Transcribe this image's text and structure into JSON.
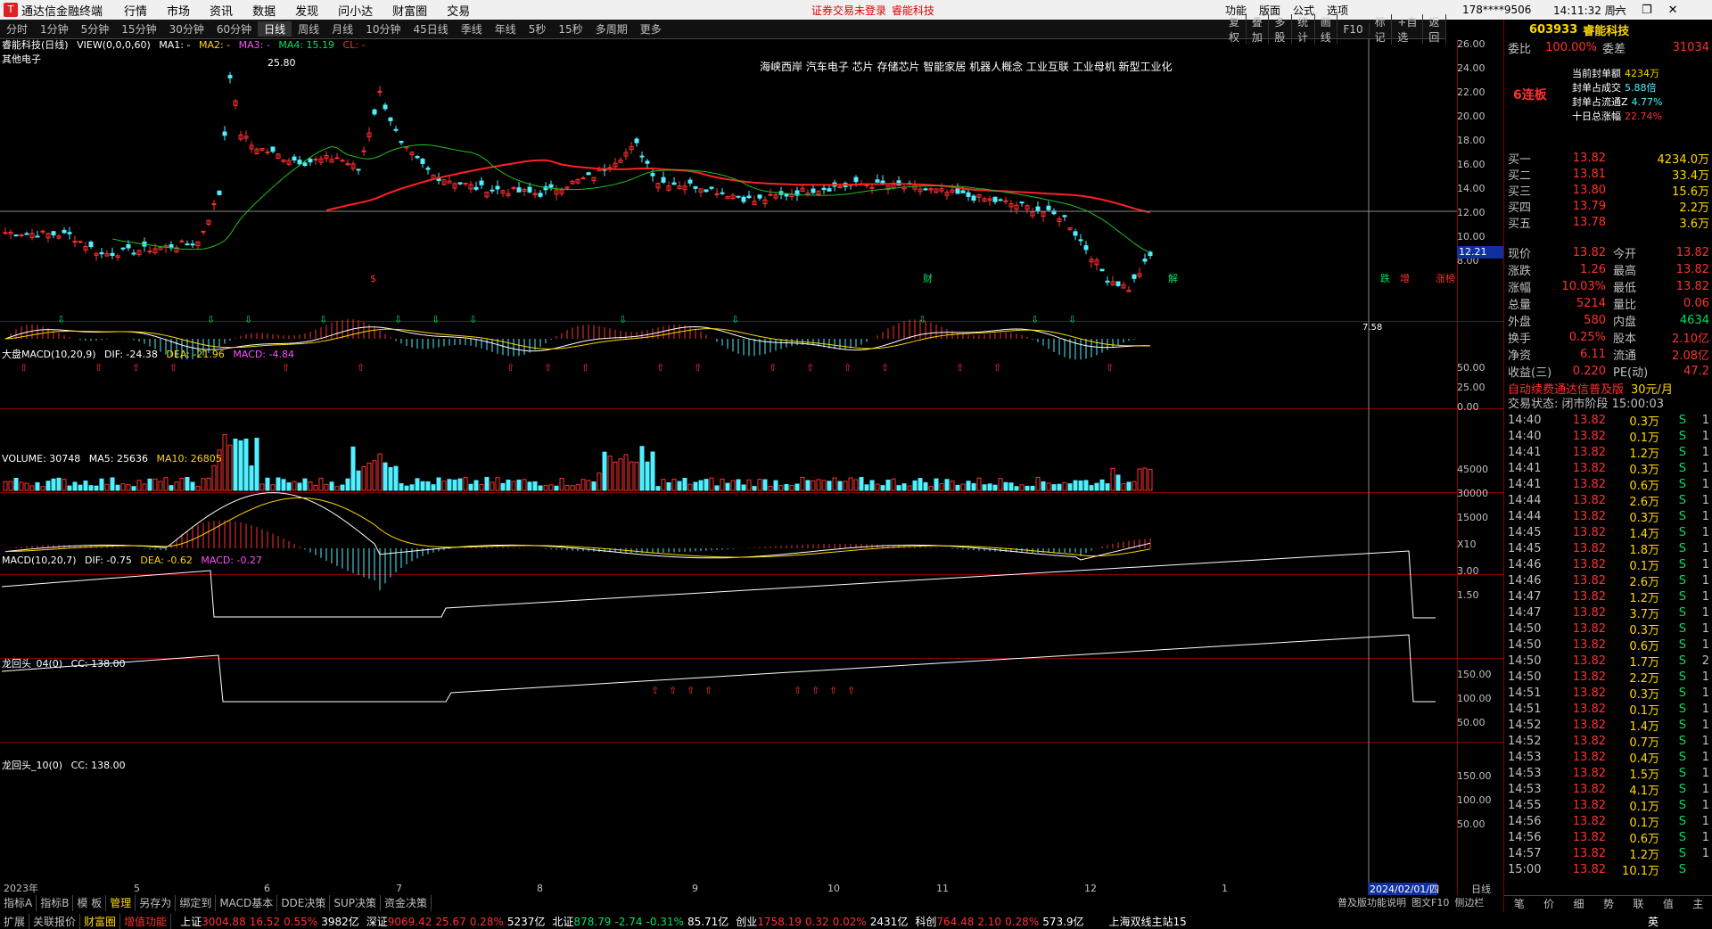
{
  "titlebar": {
    "app": "通达信金融终端",
    "menu": [
      "行情",
      "市场",
      "资讯",
      "数据",
      "发现",
      "问小达",
      "财富圈",
      "交易"
    ],
    "warning": "证券交易未登录",
    "stock": "睿能科技",
    "right_menu": [
      "功能",
      "版面",
      "公式",
      "选项"
    ],
    "user": "178****9506",
    "time": "14:11:32 周六",
    "window_controls": [
      "minimize-icon",
      "restore-icon",
      "close-icon"
    ]
  },
  "periods": [
    "分时",
    "1分钟",
    "5分钟",
    "15分钟",
    "30分钟",
    "60分钟",
    "日线",
    "周线",
    "月线",
    "10分钟",
    "45日线",
    "季线",
    "年线",
    "5秒",
    "15秒",
    "多周期",
    "更多"
  ],
  "active_period": "日线",
  "toolbtns": [
    "复权",
    "叠加",
    "多股",
    "统计",
    "画线",
    "F10",
    "标记",
    "+自选",
    "返回"
  ],
  "main": {
    "title": "睿能科技(日线)",
    "indicator": "VIEW(0,0,0,60)",
    "ma1": "MA1: -",
    "ma2": "MA2: -",
    "ma3": "MA3: -",
    "ma4": "MA4: 15.19",
    "cl": "CL: -",
    "sector": "其他电子",
    "concepts": "海峡西岸 汽车电子 芯片 存储芯片 智能家居 机器人概念 工业互联 工业母机 新型工业化",
    "max_label": "25.80",
    "min_label": "7.58",
    "price_tag": "12.21",
    "yaxis": [
      "26.00",
      "24.00",
      "22.00",
      "20.00",
      "18.00",
      "16.00",
      "14.00",
      "12.00",
      "10.00",
      "8.00"
    ],
    "markers": [
      "$",
      "财",
      "解",
      "跌",
      "增",
      "涨榜"
    ]
  },
  "macd_big": {
    "title": "大盘MACD(10,20,9)",
    "dif": "DIF: -24.38",
    "dea": "DEA: -21.96",
    "macd": "MACD: -4.84",
    "yaxis": [
      "50.00",
      "25.00",
      "0.00"
    ]
  },
  "volume": {
    "title": "VOLUME: 30748",
    "ma5": "MA5: 25636",
    "ma10": "MA10: 26805",
    "yaxis": [
      "45000",
      "30000",
      "15000"
    ],
    "unit": "X10"
  },
  "macd": {
    "title": "MACD(10,20,7)",
    "dif": "DIF: -0.75",
    "dea": "DEA: -0.62",
    "macd": "MACD: -0.27",
    "yaxis": [
      "3.00",
      "1.50"
    ]
  },
  "dragon1": {
    "title": "龙回头_04(0)",
    "cc": "CC: 138.00",
    "yaxis": [
      "150.00",
      "100.00",
      "50.00"
    ]
  },
  "dragon2": {
    "title": "龙回头_10(0)",
    "cc": "CC: 138.00",
    "yaxis": [
      "150.00",
      "100.00",
      "50.00"
    ]
  },
  "xaxis": {
    "labels": [
      "2023年",
      "5",
      "6",
      "7",
      "8",
      "9",
      "10",
      "11",
      "12",
      "1"
    ],
    "cursor_date": "2024/02/01/四",
    "period": "日线"
  },
  "rightpanel": {
    "code": "603933",
    "name": "睿能科技",
    "weibi_label": "委比",
    "weibi": "100.00%",
    "weicha_label": "委差",
    "weicha": "31034",
    "lianban": "6连板",
    "seal": [
      [
        "当前封单额",
        "4234万"
      ],
      [
        "封单占成交",
        "5.88倍"
      ],
      [
        "封单占流通Z",
        "4.77%"
      ],
      [
        "十日总涨幅",
        "22.74%"
      ]
    ],
    "buys": [
      [
        "买一",
        "13.82",
        "4234.0万"
      ],
      [
        "买二",
        "13.81",
        "33.4万"
      ],
      [
        "买三",
        "13.80",
        "15.6万"
      ],
      [
        "买四",
        "13.79",
        "2.2万"
      ],
      [
        "买五",
        "13.78",
        "3.6万"
      ]
    ],
    "quote": [
      [
        "现价",
        "13.82",
        "今开",
        "13.82"
      ],
      [
        "涨跌",
        "1.26",
        "最高",
        "13.82"
      ],
      [
        "涨幅",
        "10.03%",
        "最低",
        "13.82"
      ],
      [
        "总量",
        "5214",
        "量比",
        "0.06"
      ],
      [
        "外盘",
        "580",
        "内盘",
        "4634"
      ],
      [
        "换手",
        "0.25%",
        "股本",
        "2.10亿"
      ],
      [
        "净资",
        "6.11",
        "流通",
        "2.08亿"
      ],
      [
        "收益(三)",
        "0.220",
        "PE(动)",
        "47.2"
      ]
    ],
    "ad": "自动续费通达信普及版",
    "ad_price": "30元/月",
    "trade_state": "交易状态: 闭市阶段 15:00:03",
    "ticks": [
      [
        "14:40",
        "13.82",
        "0.3万",
        "S",
        "1"
      ],
      [
        "14:40",
        "13.82",
        "0.1万",
        "S",
        "1"
      ],
      [
        "14:41",
        "13.82",
        "1.2万",
        "S",
        "1"
      ],
      [
        "14:41",
        "13.82",
        "0.3万",
        "S",
        "1"
      ],
      [
        "14:41",
        "13.82",
        "0.6万",
        "S",
        "1"
      ],
      [
        "14:44",
        "13.82",
        "2.6万",
        "S",
        "1"
      ],
      [
        "14:44",
        "13.82",
        "0.3万",
        "S",
        "1"
      ],
      [
        "14:45",
        "13.82",
        "1.4万",
        "S",
        "1"
      ],
      [
        "14:45",
        "13.82",
        "1.8万",
        "S",
        "1"
      ],
      [
        "14:46",
        "13.82",
        "0.1万",
        "S",
        "1"
      ],
      [
        "14:46",
        "13.82",
        "2.6万",
        "S",
        "1"
      ],
      [
        "14:47",
        "13.82",
        "1.2万",
        "S",
        "1"
      ],
      [
        "14:47",
        "13.82",
        "3.7万",
        "S",
        "1"
      ],
      [
        "14:50",
        "13.82",
        "0.3万",
        "S",
        "1"
      ],
      [
        "14:50",
        "13.82",
        "0.6万",
        "S",
        "1"
      ],
      [
        "14:50",
        "13.82",
        "1.7万",
        "S",
        "2"
      ],
      [
        "14:50",
        "13.82",
        "2.2万",
        "S",
        "1"
      ],
      [
        "14:51",
        "13.82",
        "0.3万",
        "S",
        "1"
      ],
      [
        "14:51",
        "13.82",
        "0.1万",
        "S",
        "1"
      ],
      [
        "14:52",
        "13.82",
        "1.4万",
        "S",
        "1"
      ],
      [
        "14:52",
        "13.82",
        "0.7万",
        "S",
        "1"
      ],
      [
        "14:53",
        "13.82",
        "0.4万",
        "S",
        "1"
      ],
      [
        "14:53",
        "13.82",
        "1.5万",
        "S",
        "1"
      ],
      [
        "14:53",
        "13.82",
        "4.1万",
        "S",
        "1"
      ],
      [
        "14:55",
        "13.82",
        "0.1万",
        "S",
        "1"
      ],
      [
        "14:56",
        "13.82",
        "0.1万",
        "S",
        "1"
      ],
      [
        "14:56",
        "13.82",
        "0.6万",
        "S",
        "1"
      ],
      [
        "14:57",
        "13.82",
        "1.2万",
        "S",
        "1"
      ],
      [
        "15:00",
        "13.82",
        "10.1万",
        "S",
        ""
      ]
    ],
    "bottom_tabs": [
      "笔",
      "价",
      "细",
      "势",
      "联",
      "值",
      "主"
    ]
  },
  "bottom": {
    "tabs1": [
      "指标A",
      "指标B",
      "模 板",
      "管理",
      "另存为",
      "绑定到",
      "MACD基本",
      "DDE决策",
      "SUP决策",
      "资金决策"
    ],
    "tabs2": [
      "扩展",
      "关联报价",
      "财富圈",
      "增值功能"
    ],
    "notice": "普及版功能说明",
    "notice2": "图文F10",
    "notice3": "侧边栏",
    "ime": "英"
  },
  "status": [
    {
      "name": "上证",
      "value": "3004.88",
      "chg": "16.52",
      "pct": "0.55%",
      "amt": "3982亿"
    },
    {
      "name": "深证",
      "value": "9069.42",
      "chg": "25.67",
      "pct": "0.28%",
      "amt": "5237亿"
    },
    {
      "name": "北证",
      "value": "878.79",
      "chg": "-2.74",
      "pct": "-0.31%",
      "amt": "85.71亿"
    },
    {
      "name": "创业",
      "value": "1758.19",
      "chg": "0.32",
      "pct": "0.02%",
      "amt": "2431亿"
    },
    {
      "name": "科创",
      "value": "764.48",
      "chg": "2.10",
      "pct": "0.28%",
      "amt": "573.9亿"
    }
  ],
  "server": "上海双线主站15"
}
